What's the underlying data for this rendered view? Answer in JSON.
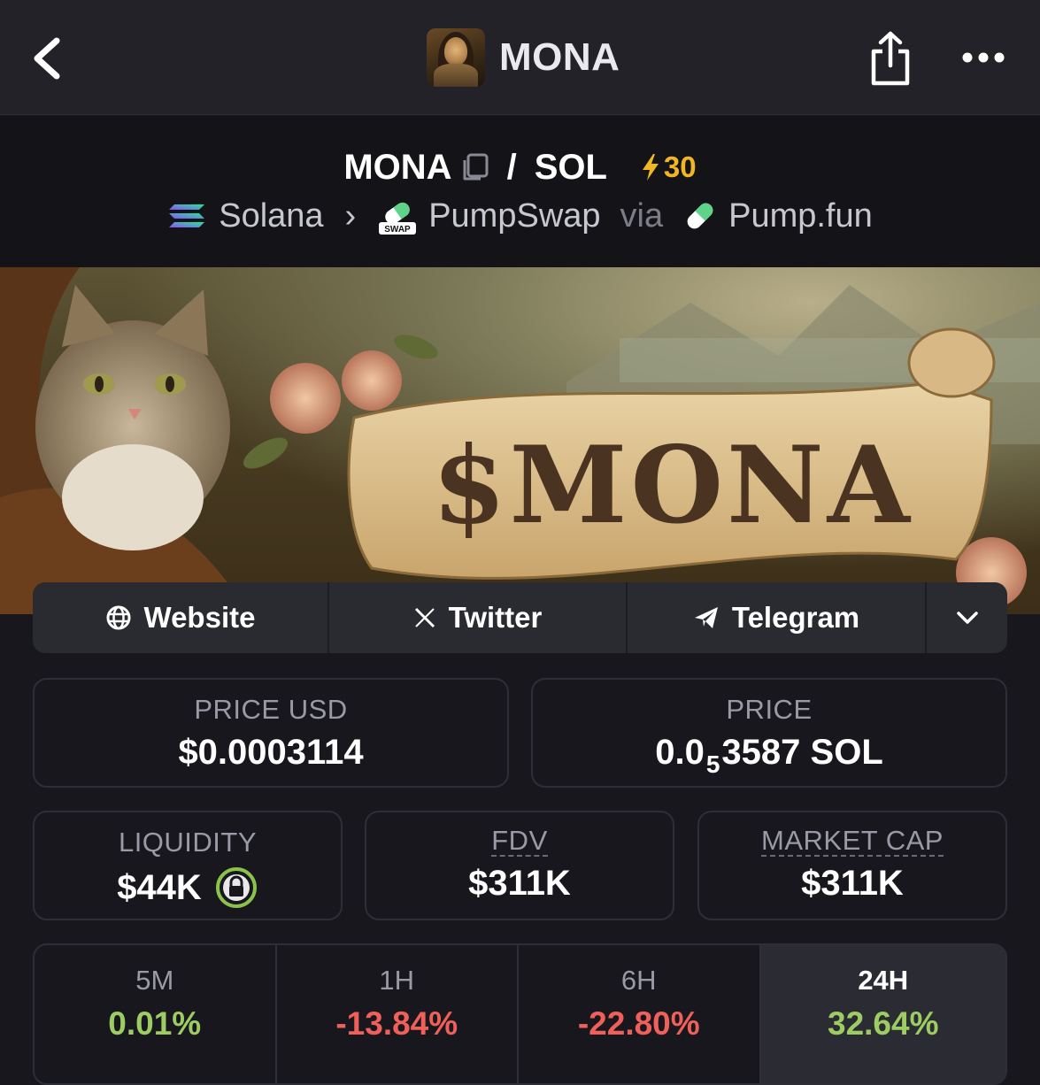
{
  "nav": {
    "title": "MONA"
  },
  "pair": {
    "base": "MONA",
    "separator": "/",
    "quote": "SOL",
    "boost": "30",
    "chain": "Solana",
    "dex": "PumpSwap",
    "via": "via",
    "launchpad": "Pump.fun",
    "dex_badge": "SWAP"
  },
  "banner": {
    "text": "$MONA"
  },
  "links": {
    "website": "Website",
    "twitter": "Twitter",
    "telegram": "Telegram"
  },
  "stats": {
    "price_usd_label": "PRICE USD",
    "price_usd": "$0.0003114",
    "price_label": "PRICE",
    "price_prefix": "0.0",
    "price_sub": "5",
    "price_suffix": "3587 SOL",
    "liquidity_label": "LIQUIDITY",
    "liquidity": "$44K",
    "fdv_label": "FDV",
    "fdv": "$311K",
    "mcap_label": "MARKET CAP",
    "mcap": "$311K"
  },
  "timeframes": [
    {
      "label": "5M",
      "change": "0.01%"
    },
    {
      "label": "1H",
      "change": "-13.84%"
    },
    {
      "label": "6H",
      "change": "-22.80%"
    },
    {
      "label": "24H",
      "change": "32.64%"
    }
  ],
  "colors": {
    "positive": "#9ccc62",
    "negative": "#f0605a",
    "boost": "#f3b623",
    "background": "#17171d"
  },
  "icons": {
    "back": "chevron-left-icon",
    "share": "share-icon",
    "more": "more-horizontal-icon",
    "copy": "copy-icon",
    "boost": "lightning-icon",
    "chain": "solana-icon",
    "dex": "pumpswap-icon",
    "launchpad": "pill-icon",
    "website": "globe-icon",
    "twitter": "x-icon",
    "telegram": "telegram-icon",
    "expand": "chevron-down-icon",
    "lock": "lock-icon"
  }
}
